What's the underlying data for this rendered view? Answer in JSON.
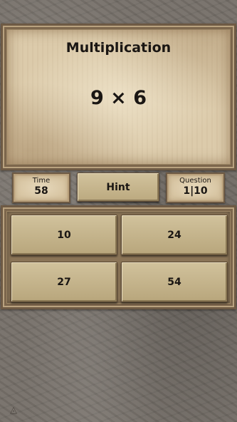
{
  "game": {
    "title": "Multiplication",
    "problem": "9 × 6",
    "time_label": "Time",
    "time_value": "58",
    "question_label": "Question",
    "question_value": "1|10",
    "hint_label": "Hint"
  },
  "answers": [
    "10",
    "24",
    "27",
    "54"
  ],
  "colors": {
    "background_stone": "#77716a",
    "frame_wood": "#6e5a44",
    "parchment": "#dccbab",
    "button": "#c8b88f",
    "text": "#1a1613"
  }
}
